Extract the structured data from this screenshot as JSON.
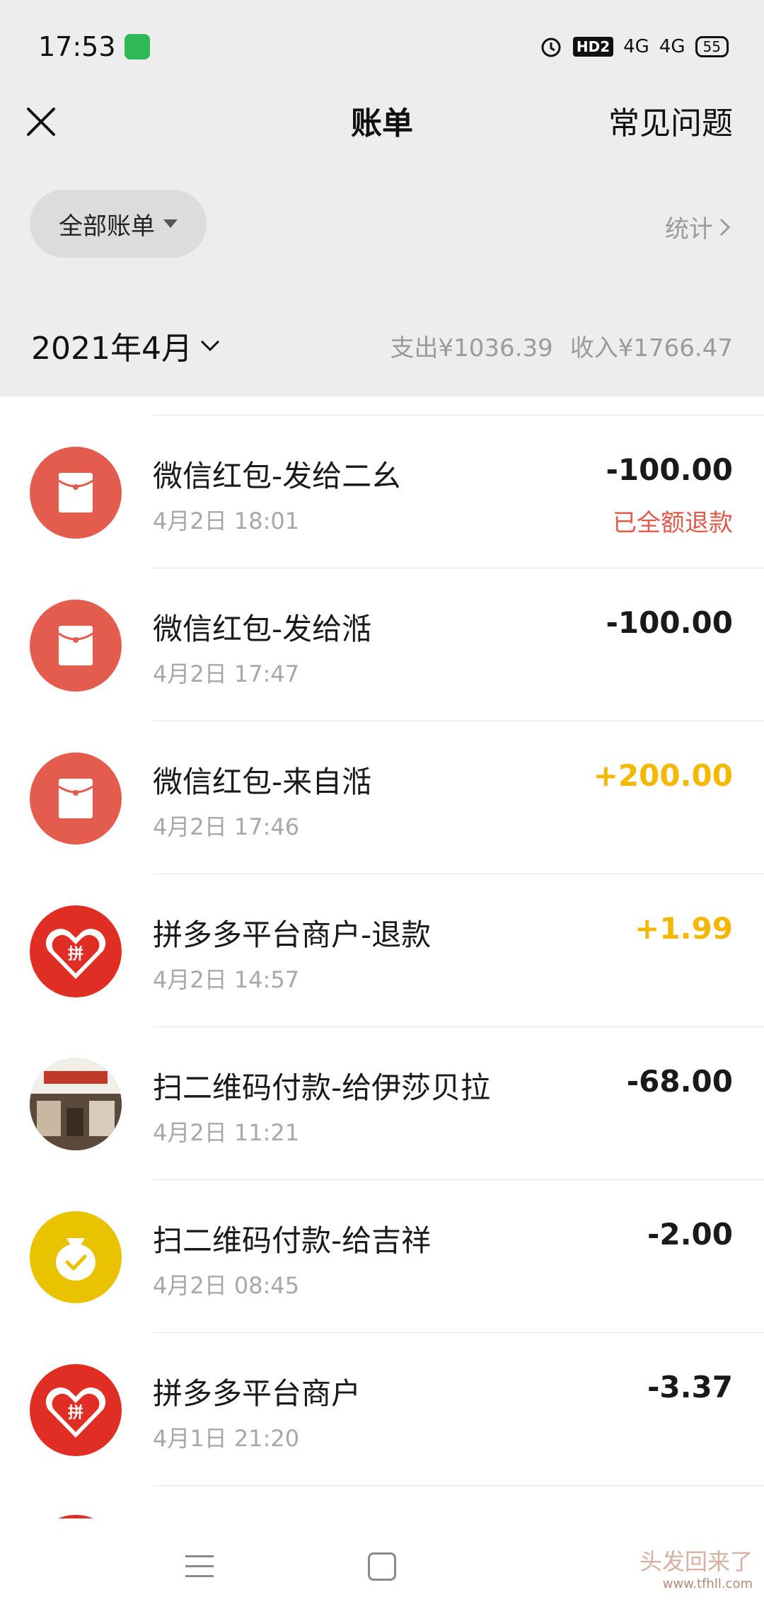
{
  "status_bar": {
    "time": "17:53",
    "hd_label": "HD2",
    "signal1": "4G",
    "signal2": "4G",
    "battery": "55",
    "icons": [
      "app-notification-icon",
      "alarm-icon",
      "hd-icon",
      "signal-icon",
      "signal-icon",
      "battery-icon"
    ]
  },
  "header": {
    "title": "账单",
    "faq_label": "常见问题",
    "close_icon": "close-icon"
  },
  "filter": {
    "all_bills_label": "全部账单",
    "stats_label": "统计"
  },
  "month": {
    "label": "2021年4月",
    "expense_label": "支出¥1036.39",
    "income_label": "收入¥1766.47"
  },
  "transactions": [
    {
      "title": "微信红包-发给二幺",
      "time": "4月2日 18:01",
      "amount": "-100.00",
      "type": "expense",
      "note": "已全额退款",
      "icon": "red-packet-icon"
    },
    {
      "title": "微信红包-发给湉",
      "time": "4月2日 17:47",
      "amount": "-100.00",
      "type": "expense",
      "note": "",
      "icon": "red-packet-icon"
    },
    {
      "title": "微信红包-来自湉",
      "time": "4月2日 17:46",
      "amount": "+200.00",
      "type": "income",
      "note": "",
      "icon": "red-packet-icon"
    },
    {
      "title": "拼多多平台商户-退款",
      "time": "4月2日 14:57",
      "amount": "+1.99",
      "type": "income",
      "note": "",
      "icon": "pinduoduo-logo-icon"
    },
    {
      "title": "扫二维码付款-给伊莎贝拉",
      "time": "4月2日 11:21",
      "amount": "-68.00",
      "type": "expense",
      "note": "",
      "icon": "shop-photo-avatar"
    },
    {
      "title": "扫二维码付款-给吉祥",
      "time": "4月2日 08:45",
      "amount": "-2.00",
      "type": "expense",
      "note": "",
      "icon": "money-bag-icon"
    },
    {
      "title": "拼多多平台商户",
      "time": "4月1日 21:20",
      "amount": "-3.37",
      "type": "expense",
      "note": "",
      "icon": "pinduoduo-logo-icon"
    }
  ],
  "colors": {
    "background_gray": "#ededed",
    "red_packet": "#e45c4e",
    "pinduoduo_red": "#e02e24",
    "income_yellow": "#f5b800",
    "refund_red": "#e15a4a",
    "muted_text": "#a8a8a8"
  },
  "watermark": {
    "text": "头发回来了",
    "url": "www.tfhll.com"
  }
}
